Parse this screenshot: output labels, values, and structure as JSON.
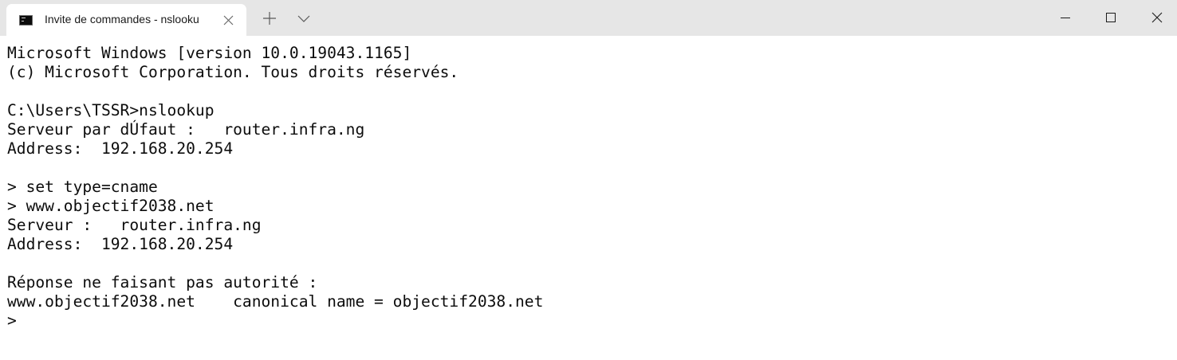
{
  "tab": {
    "title": "Invite de commandes - nslooku"
  },
  "icons": {
    "tab_icon": "cmd-icon",
    "tab_close": "close-icon",
    "new_tab": "plus-icon",
    "dropdown": "chevron-down-icon",
    "minimize": "minimize-icon",
    "maximize": "maximize-icon",
    "close": "close-icon"
  },
  "console": {
    "lines": [
      "Microsoft Windows [version 10.0.19043.1165]",
      "(c) Microsoft Corporation. Tous droits réservés.",
      "",
      "C:\\Users\\TSSR>nslookup",
      "Serveur par dÚfaut :   router.infra.ng",
      "Address:  192.168.20.254",
      "",
      "> set type=cname",
      "> www.objectif2038.net",
      "Serveur :   router.infra.ng",
      "Address:  192.168.20.254",
      "",
      "Réponse ne faisant pas autorité :",
      "www.objectif2038.net    canonical name = objectif2038.net",
      ">"
    ]
  }
}
